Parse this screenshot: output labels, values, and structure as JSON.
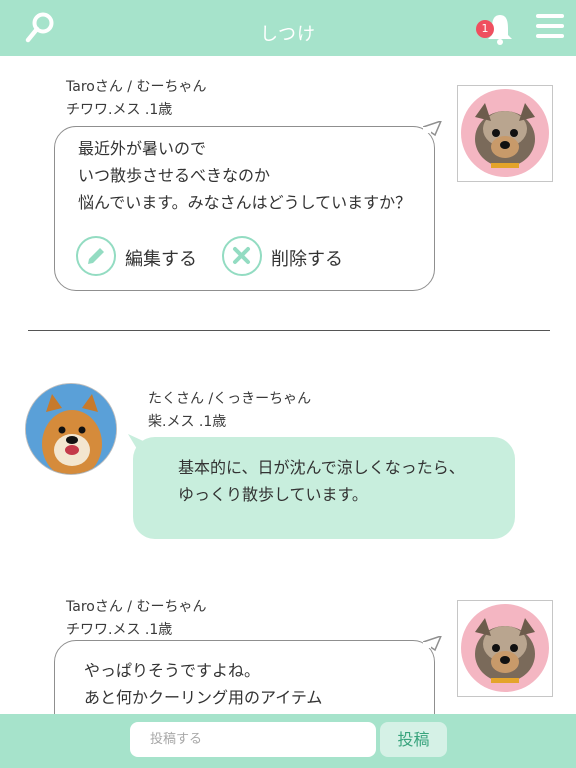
{
  "header": {
    "title": "しつけ",
    "search_icon": "search-icon",
    "bell_icon": "bell-icon",
    "notification_count": "1",
    "menu_icon": "hamburger-menu-icon"
  },
  "posts": [
    {
      "user": "Taroさん / むーちゃん",
      "dog": "チワワ.メス .1歳",
      "lines": [
        "最近外が暑いので",
        "いつ散歩させるべきなのか",
        "悩んでいます。みなさんはどうしていますか？"
      ],
      "edit_label": "編集する",
      "delete_label": "削除する"
    },
    {
      "user": "たくさん /くっきーちゃん",
      "dog": "柴.メス .1歳",
      "lines": [
        "基本的に、日が沈んで涼しくなったら、",
        "ゆっくり散歩しています。"
      ]
    },
    {
      "user": "Taroさん / むーちゃん",
      "dog": "チワワ.メス .1歳",
      "lines": [
        "やっぱりそうですよね。",
        "あと何かクーリング用のアイテム"
      ]
    }
  ],
  "footer": {
    "input_placeholder": "投稿する",
    "post_button": "投稿"
  },
  "colors": {
    "accent": "#a6e3cb",
    "bubble_in": "#c8eedd",
    "badge": "#ef4f5f"
  }
}
